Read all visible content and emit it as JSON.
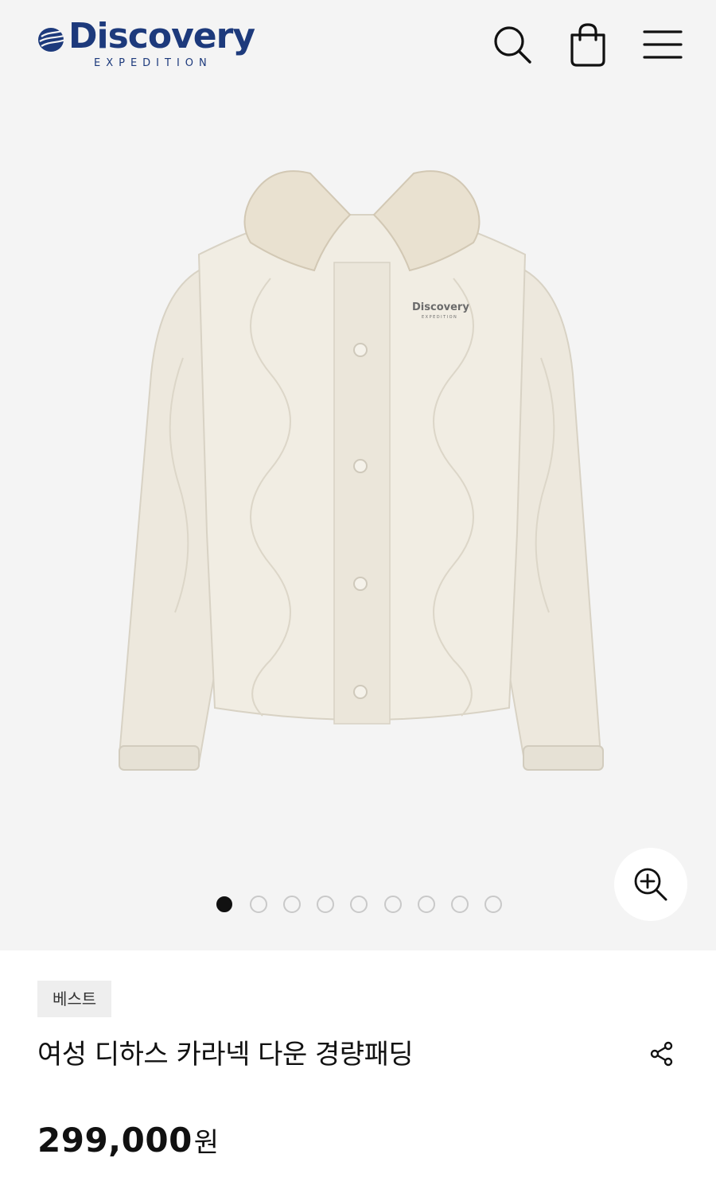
{
  "header": {
    "brand": "Discovery",
    "brand_sub": "EXPEDITION",
    "brand_color": "#1d3a7c",
    "icons": [
      "search-icon",
      "shopping-bag-icon",
      "menu-icon"
    ]
  },
  "gallery": {
    "current_index": 1,
    "total": 9,
    "zoom_icon": "zoom-in-icon",
    "jacket_print": "Discovery",
    "jacket_print_sub": "EXPEDITION"
  },
  "product": {
    "badge": "베스트",
    "title": "여성 디하스 카라넥 다운 경량패딩",
    "price": "299,000",
    "currency": "원",
    "share_icon": "share-icon"
  }
}
